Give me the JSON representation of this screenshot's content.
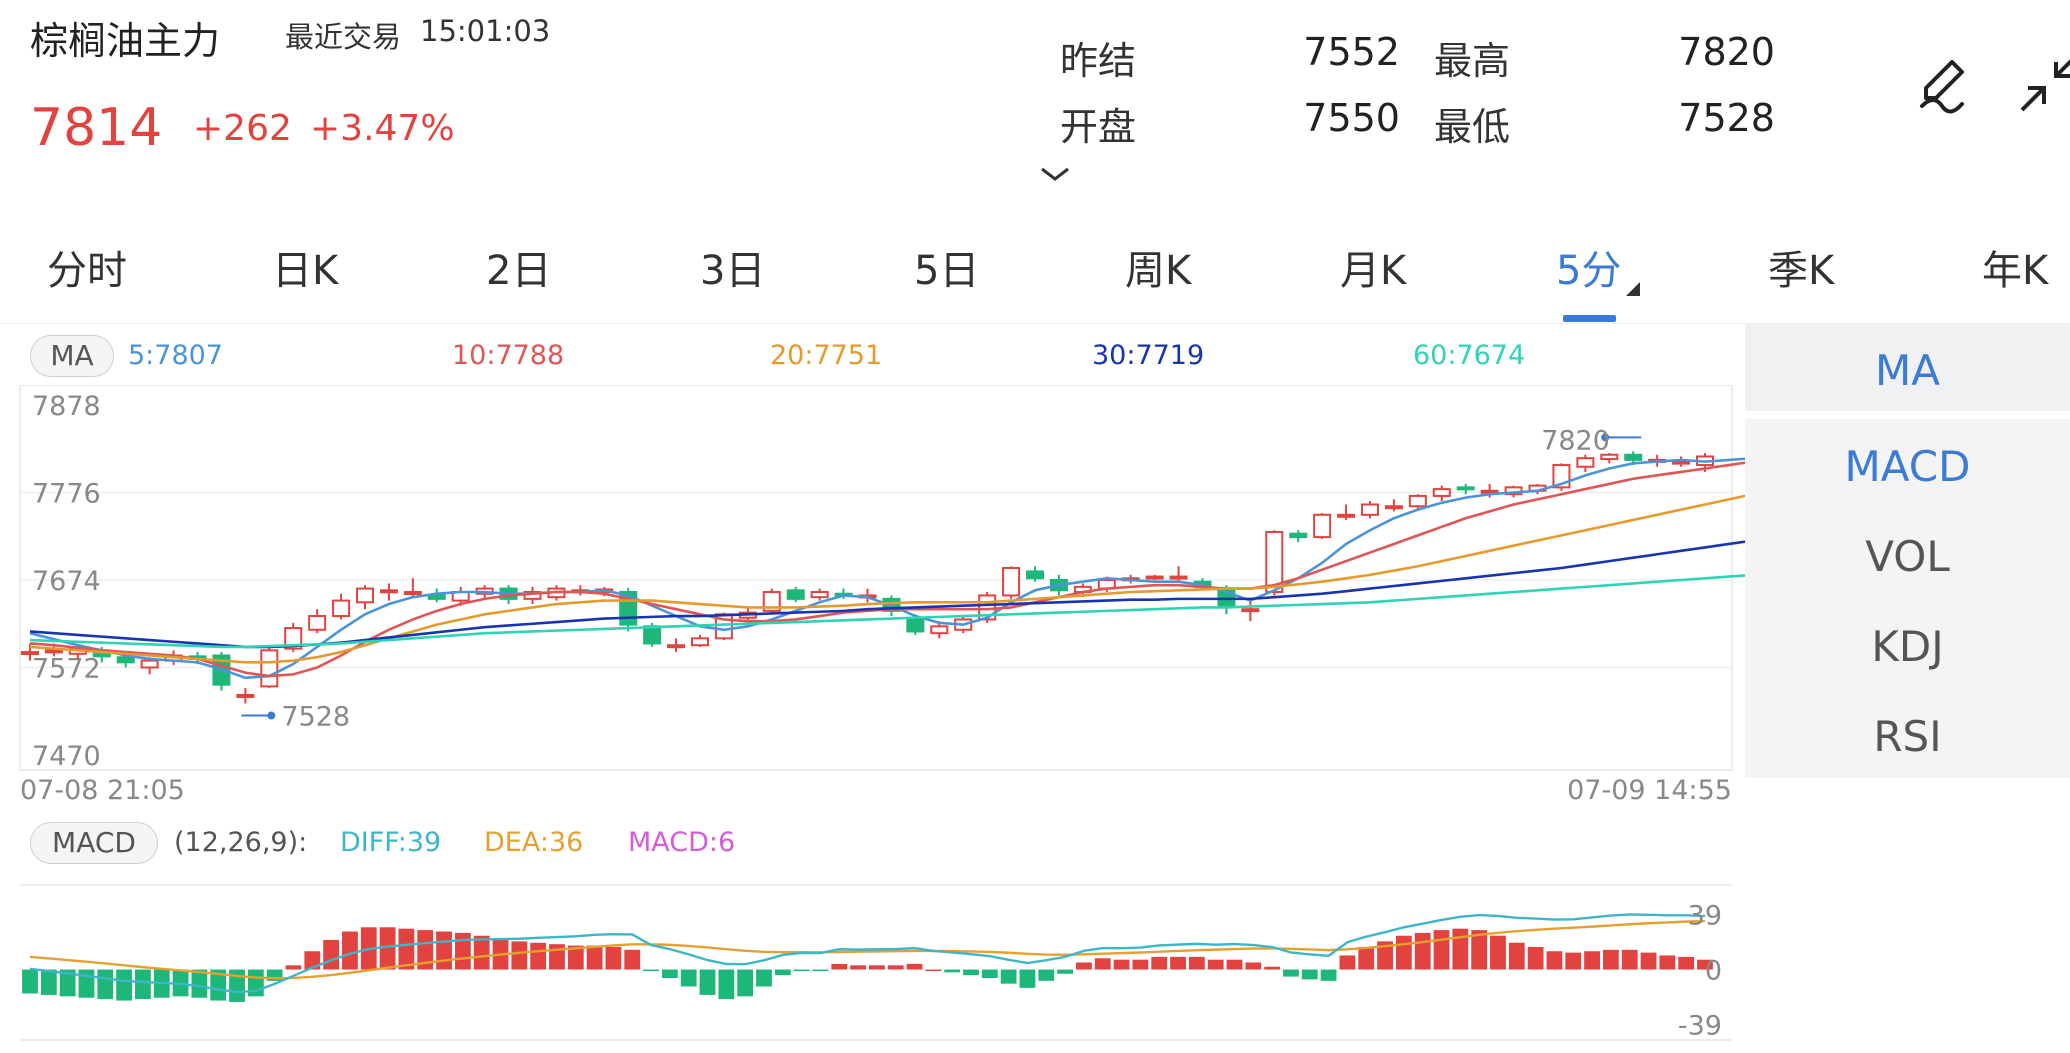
{
  "header": {
    "title": "棕榈油主力",
    "trade_label": "最近交易",
    "trade_time": "15:01:03",
    "price": "7814",
    "change": "+262",
    "change_pct": "+3.47%"
  },
  "stats": {
    "prev_settle_label": "昨结",
    "prev_settle": "7552",
    "high_label": "最高",
    "high": "7820",
    "open_label": "开盘",
    "open": "7550",
    "low_label": "最低",
    "low": "7528"
  },
  "icons": {
    "edit": "pencil-icon",
    "collapse": "collapse-arrows-icon",
    "expand": "chevron-down-icon"
  },
  "tabs": [
    {
      "label": "分时"
    },
    {
      "label": "日K"
    },
    {
      "label": "2日"
    },
    {
      "label": "3日"
    },
    {
      "label": "5日"
    },
    {
      "label": "周K"
    },
    {
      "label": "月K"
    },
    {
      "label": "5分",
      "active": true
    },
    {
      "label": "季K"
    },
    {
      "label": "年K"
    }
  ],
  "ma_legend": {
    "pill": "MA",
    "ma5": "5:7807",
    "ma10": "10:7788",
    "ma20": "20:7751",
    "ma30": "30:7719",
    "ma60": "60:7674"
  },
  "macd_legend": {
    "pill": "MACD",
    "params": "(12,26,9):",
    "diff": "DIFF:39",
    "dea": "DEA:36",
    "macd": "MACD:6"
  },
  "side_menu": [
    "MA",
    "MACD",
    "VOL",
    "KDJ",
    "RSI"
  ],
  "colors": {
    "up": "#e2433f",
    "down": "#1db77a",
    "accent": "#3b7ad7",
    "ma5": "#4b94d8",
    "ma10": "#e05555",
    "ma20": "#e69a2e",
    "ma30": "#1834b0",
    "ma60": "#2fd4b4",
    "diff": "#3db6c9",
    "dea": "#e6a030",
    "macd": "#d95ad9"
  },
  "chart_data": [
    {
      "type": "candlestick",
      "y_axis_labels": [
        "7878",
        "7776",
        "7674",
        "7572",
        "7470"
      ],
      "ylim": [
        7470,
        7878
      ],
      "x_start_label": "07-08 21:05",
      "x_end_label": "07-09 14:55",
      "high_marker": "7820",
      "low_marker": "7528",
      "candles": [
        {
          "o": 7590,
          "c": 7590,
          "h": 7600,
          "l": 7580
        },
        {
          "o": 7590,
          "c": 7592,
          "h": 7600,
          "l": 7585
        },
        {
          "o": 7588,
          "c": 7594,
          "h": 7598,
          "l": 7582
        },
        {
          "o": 7592,
          "c": 7585,
          "h": 7596,
          "l": 7578
        },
        {
          "o": 7584,
          "c": 7578,
          "h": 7588,
          "l": 7572
        },
        {
          "o": 7572,
          "c": 7580,
          "h": 7584,
          "l": 7564
        },
        {
          "o": 7580,
          "c": 7586,
          "h": 7592,
          "l": 7575
        },
        {
          "o": 7585,
          "c": 7582,
          "h": 7590,
          "l": 7576
        },
        {
          "o": 7586,
          "c": 7552,
          "h": 7590,
          "l": 7545
        },
        {
          "o": 7540,
          "c": 7540,
          "h": 7548,
          "l": 7530
        },
        {
          "o": 7550,
          "c": 7592,
          "h": 7598,
          "l": 7548
        },
        {
          "o": 7594,
          "c": 7618,
          "h": 7624,
          "l": 7590
        },
        {
          "o": 7616,
          "c": 7632,
          "h": 7640,
          "l": 7612
        },
        {
          "o": 7632,
          "c": 7650,
          "h": 7658,
          "l": 7628
        },
        {
          "o": 7648,
          "c": 7664,
          "h": 7668,
          "l": 7640
        },
        {
          "o": 7662,
          "c": 7662,
          "h": 7670,
          "l": 7650
        },
        {
          "o": 7660,
          "c": 7660,
          "h": 7676,
          "l": 7654
        },
        {
          "o": 7656,
          "c": 7652,
          "h": 7664,
          "l": 7648
        },
        {
          "o": 7650,
          "c": 7660,
          "h": 7666,
          "l": 7644
        },
        {
          "o": 7658,
          "c": 7664,
          "h": 7668,
          "l": 7652
        },
        {
          "o": 7664,
          "c": 7652,
          "h": 7668,
          "l": 7646
        },
        {
          "o": 7652,
          "c": 7660,
          "h": 7666,
          "l": 7646
        },
        {
          "o": 7654,
          "c": 7664,
          "h": 7668,
          "l": 7650
        },
        {
          "o": 7662,
          "c": 7662,
          "h": 7668,
          "l": 7656
        },
        {
          "o": 7660,
          "c": 7663,
          "h": 7666,
          "l": 7655
        },
        {
          "o": 7660,
          "c": 7622,
          "h": 7665,
          "l": 7614
        },
        {
          "o": 7620,
          "c": 7600,
          "h": 7624,
          "l": 7596
        },
        {
          "o": 7598,
          "c": 7598,
          "h": 7606,
          "l": 7590
        },
        {
          "o": 7598,
          "c": 7606,
          "h": 7610,
          "l": 7596
        },
        {
          "o": 7606,
          "c": 7634,
          "h": 7636,
          "l": 7604
        },
        {
          "o": 7630,
          "c": 7636,
          "h": 7642,
          "l": 7626
        },
        {
          "o": 7638,
          "c": 7660,
          "h": 7664,
          "l": 7636
        },
        {
          "o": 7662,
          "c": 7652,
          "h": 7666,
          "l": 7648
        },
        {
          "o": 7654,
          "c": 7660,
          "h": 7664,
          "l": 7650
        },
        {
          "o": 7658,
          "c": 7656,
          "h": 7664,
          "l": 7652
        },
        {
          "o": 7654,
          "c": 7656,
          "h": 7664,
          "l": 7648
        },
        {
          "o": 7652,
          "c": 7638,
          "h": 7656,
          "l": 7632
        },
        {
          "o": 7630,
          "c": 7614,
          "h": 7634,
          "l": 7610
        },
        {
          "o": 7612,
          "c": 7620,
          "h": 7626,
          "l": 7606
        },
        {
          "o": 7616,
          "c": 7628,
          "h": 7632,
          "l": 7612
        },
        {
          "o": 7628,
          "c": 7656,
          "h": 7660,
          "l": 7624
        },
        {
          "o": 7656,
          "c": 7688,
          "h": 7690,
          "l": 7652
        },
        {
          "o": 7684,
          "c": 7676,
          "h": 7690,
          "l": 7672
        },
        {
          "o": 7674,
          "c": 7662,
          "h": 7680,
          "l": 7656
        },
        {
          "o": 7660,
          "c": 7666,
          "h": 7670,
          "l": 7654
        },
        {
          "o": 7664,
          "c": 7674,
          "h": 7678,
          "l": 7660
        },
        {
          "o": 7674,
          "c": 7676,
          "h": 7680,
          "l": 7670
        },
        {
          "o": 7676,
          "c": 7678,
          "h": 7680,
          "l": 7674
        },
        {
          "o": 7676,
          "c": 7678,
          "h": 7690,
          "l": 7672
        },
        {
          "o": 7672,
          "c": 7666,
          "h": 7676,
          "l": 7662
        },
        {
          "o": 7664,
          "c": 7644,
          "h": 7668,
          "l": 7634
        },
        {
          "o": 7640,
          "c": 7640,
          "h": 7652,
          "l": 7626
        },
        {
          "o": 7660,
          "c": 7730,
          "h": 7732,
          "l": 7656
        },
        {
          "o": 7728,
          "c": 7724,
          "h": 7732,
          "l": 7718
        },
        {
          "o": 7724,
          "c": 7750,
          "h": 7752,
          "l": 7722
        },
        {
          "o": 7750,
          "c": 7750,
          "h": 7762,
          "l": 7744
        },
        {
          "o": 7750,
          "c": 7762,
          "h": 7766,
          "l": 7746
        },
        {
          "o": 7760,
          "c": 7760,
          "h": 7768,
          "l": 7754
        },
        {
          "o": 7760,
          "c": 7772,
          "h": 7774,
          "l": 7756
        },
        {
          "o": 7772,
          "c": 7780,
          "h": 7784,
          "l": 7766
        },
        {
          "o": 7782,
          "c": 7780,
          "h": 7786,
          "l": 7774
        },
        {
          "o": 7778,
          "c": 7778,
          "h": 7786,
          "l": 7770
        },
        {
          "o": 7774,
          "c": 7782,
          "h": 7784,
          "l": 7770
        },
        {
          "o": 7778,
          "c": 7784,
          "h": 7786,
          "l": 7774
        },
        {
          "o": 7782,
          "c": 7808,
          "h": 7810,
          "l": 7778
        },
        {
          "o": 7806,
          "c": 7816,
          "h": 7820,
          "l": 7800
        },
        {
          "o": 7815,
          "c": 7820,
          "h": 7822,
          "l": 7810
        },
        {
          "o": 7820,
          "c": 7814,
          "h": 7824,
          "l": 7808
        },
        {
          "o": 7814,
          "c": 7814,
          "h": 7820,
          "l": 7806
        },
        {
          "o": 7812,
          "c": 7812,
          "h": 7818,
          "l": 7806
        },
        {
          "o": 7808,
          "c": 7818,
          "h": 7822,
          "l": 7800
        }
      ],
      "series": [
        {
          "name": "5",
          "values": [
            7612,
            7605,
            7598,
            7592,
            7586,
            7582,
            7580,
            7578,
            7570,
            7560,
            7562,
            7576,
            7596,
            7616,
            7634,
            7646,
            7654,
            7658,
            7660,
            7660,
            7658,
            7658,
            7660,
            7660,
            7662,
            7656,
            7644,
            7632,
            7620,
            7616,
            7620,
            7628,
            7638,
            7648,
            7656,
            7654,
            7644,
            7632,
            7624,
            7622,
            7630,
            7648,
            7662,
            7668,
            7672,
            7676,
            7674,
            7672,
            7672,
            7668,
            7660,
            7650,
            7662,
            7676,
            7694,
            7716,
            7732,
            7746,
            7756,
            7764,
            7770,
            7774,
            7776,
            7778,
            7786,
            7796,
            7804,
            7810,
            7812,
            7814,
            7812,
            7814,
            7816
          ]
        },
        {
          "name": "10",
          "values": [
            7600,
            7598,
            7595,
            7592,
            7590,
            7588,
            7586,
            7582,
            7574,
            7566,
            7562,
            7564,
            7572,
            7586,
            7602,
            7616,
            7628,
            7638,
            7646,
            7652,
            7656,
            7658,
            7660,
            7660,
            7658,
            7652,
            7646,
            7640,
            7634,
            7628,
            7626,
            7626,
            7628,
            7632,
            7636,
            7638,
            7640,
            7640,
            7640,
            7640,
            7640,
            7642,
            7648,
            7654,
            7660,
            7664,
            7666,
            7668,
            7668,
            7666,
            7664,
            7664,
            7668,
            7676,
            7686,
            7696,
            7706,
            7716,
            7726,
            7736,
            7746,
            7754,
            7762,
            7768,
            7774,
            7780,
            7786,
            7792,
            7796,
            7800,
            7804,
            7808,
            7812
          ]
        },
        {
          "name": "20",
          "values": [
            7596,
            7594,
            7592,
            7590,
            7588,
            7586,
            7584,
            7582,
            7580,
            7578,
            7578,
            7580,
            7584,
            7590,
            7598,
            7606,
            7614,
            7622,
            7628,
            7634,
            7638,
            7642,
            7646,
            7648,
            7650,
            7650,
            7650,
            7648,
            7646,
            7644,
            7642,
            7642,
            7642,
            7643,
            7644,
            7646,
            7647,
            7648,
            7648,
            7648,
            7648,
            7650,
            7652,
            7654,
            7656,
            7658,
            7660,
            7661,
            7662,
            7663,
            7664,
            7664,
            7666,
            7669,
            7672,
            7676,
            7680,
            7685,
            7690,
            7696,
            7702,
            7708,
            7714,
            7720,
            7726,
            7732,
            7738,
            7744,
            7750,
            7756,
            7762,
            7768,
            7774
          ]
        },
        {
          "name": "30",
          "values": [
            7614,
            7612,
            7610,
            7608,
            7606,
            7604,
            7602,
            7600,
            7598,
            7596,
            7596,
            7597,
            7599,
            7601,
            7604,
            7607,
            7610,
            7613,
            7616,
            7619,
            7621,
            7623,
            7625,
            7627,
            7629,
            7630,
            7631,
            7632,
            7632,
            7633,
            7634,
            7635,
            7636,
            7637,
            7638,
            7640,
            7641,
            7642,
            7643,
            7644,
            7645,
            7646,
            7647,
            7648,
            7649,
            7650,
            7651,
            7651,
            7652,
            7652,
            7652,
            7652,
            7654,
            7656,
            7658,
            7661,
            7664,
            7667,
            7670,
            7673,
            7676,
            7679,
            7682,
            7685,
            7688,
            7692,
            7696,
            7700,
            7704,
            7708,
            7712,
            7716,
            7720
          ]
        },
        {
          "name": "60",
          "values": [
            7604,
            7603,
            7602,
            7601,
            7600,
            7599,
            7598,
            7597,
            7596,
            7596,
            7597,
            7598,
            7599,
            7600,
            7602,
            7604,
            7606,
            7608,
            7610,
            7612,
            7613,
            7614,
            7615,
            7616,
            7617,
            7618,
            7619,
            7620,
            7621,
            7622,
            7623,
            7624,
            7625,
            7626,
            7627,
            7628,
            7629,
            7630,
            7631,
            7632,
            7633,
            7634,
            7635,
            7636,
            7637,
            7638,
            7639,
            7640,
            7641,
            7642,
            7642,
            7643,
            7644,
            7645,
            7646,
            7647,
            7648,
            7650,
            7652,
            7654,
            7656,
            7658,
            7660,
            7662,
            7664,
            7666,
            7668,
            7670,
            7672,
            7674,
            7676,
            7678,
            7680
          ]
        }
      ]
    },
    {
      "type": "bar",
      "name": "MACD",
      "y_axis_labels": [
        "39",
        "0",
        "-39"
      ],
      "ylim": [
        -50,
        60
      ],
      "histogram": [
        -17,
        -18,
        -19,
        -20,
        -21,
        -22,
        -21,
        -20,
        -19,
        -20,
        -22,
        -23,
        -19,
        -8,
        3,
        13,
        21,
        27,
        30,
        30,
        29,
        28,
        27,
        26,
        24,
        22,
        20,
        19,
        18,
        17,
        17,
        16,
        14,
        -1,
        -6,
        -12,
        -18,
        -21,
        -19,
        -12,
        -4,
        -1,
        -1,
        4,
        3,
        3,
        3,
        4,
        0,
        -2,
        -4,
        -6,
        -10,
        -13,
        -8,
        -3,
        5,
        8,
        7,
        7,
        9,
        9,
        9,
        7,
        7,
        5,
        2,
        -5,
        -7,
        -8,
        10,
        16,
        20,
        24,
        26,
        28,
        29,
        28,
        24,
        19,
        16,
        13,
        12,
        13,
        14,
        14,
        12,
        10,
        9,
        7
      ]
    }
  ]
}
